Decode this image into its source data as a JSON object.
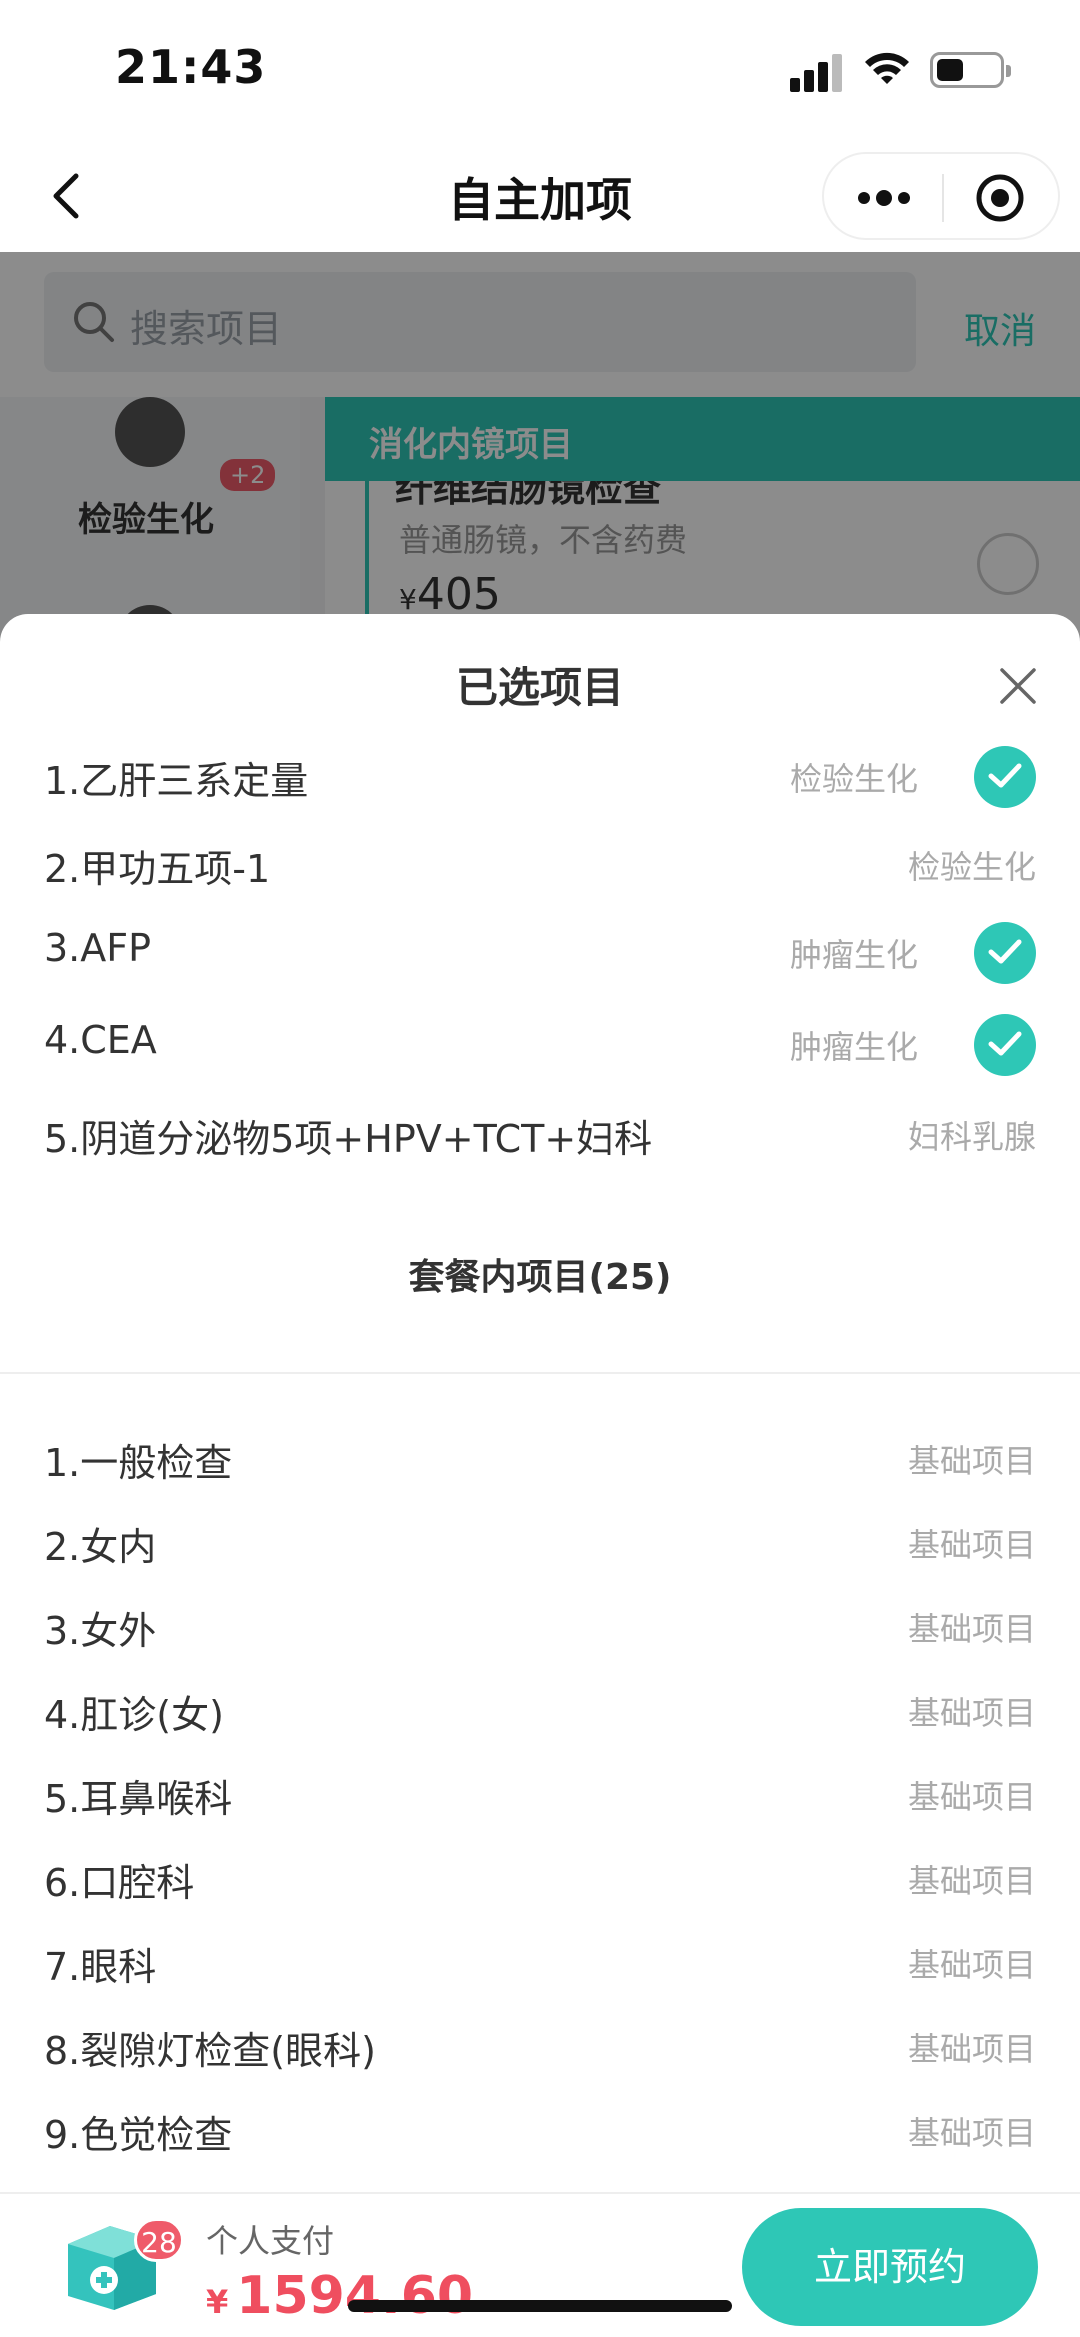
{
  "status_bar": {
    "time": "21:43"
  },
  "nav": {
    "title": "自主加项"
  },
  "search": {
    "placeholder": "搜索项目",
    "cancel": "取消"
  },
  "background": {
    "category_label": "检验生化",
    "category_badge": "+2",
    "section_header": "消化内镜项目",
    "card_title": "纤维结肠镜检查",
    "card_subtitle": "普通肠镜，不含药费",
    "card_currency": "¥",
    "card_price": "405"
  },
  "selected": {
    "title": "已选项目",
    "items": [
      {
        "name": "1.乙肝三系定量",
        "category": "检验生化",
        "checked": true
      },
      {
        "name": "2.甲功五项-1",
        "category": "检验生化",
        "checked": false
      },
      {
        "name": "3.AFP",
        "category": "肿瘤生化",
        "checked": true
      },
      {
        "name": "4.CEA",
        "category": "肿瘤生化",
        "checked": true
      },
      {
        "name": "5.阴道分泌物5项+HPV+TCT+妇科",
        "category": "妇科乳腺",
        "checked": false
      }
    ]
  },
  "package": {
    "title": "套餐内项目(25)",
    "items": [
      {
        "name": "1.一般检查",
        "category": "基础项目"
      },
      {
        "name": "2.女内",
        "category": "基础项目"
      },
      {
        "name": "3.女外",
        "category": "基础项目"
      },
      {
        "name": "4.肛诊(女)",
        "category": "基础项目"
      },
      {
        "name": "5.耳鼻喉科",
        "category": "基础项目"
      },
      {
        "name": "6.口腔科",
        "category": "基础项目"
      },
      {
        "name": "7.眼科",
        "category": "基础项目"
      },
      {
        "name": "8.裂隙灯检查(眼科)",
        "category": "基础项目"
      },
      {
        "name": "9.色觉检查",
        "category": "基础项目"
      }
    ]
  },
  "bottom": {
    "cart_count": "28",
    "pay_label": "个人支付",
    "currency": "¥",
    "amount": "1594.60",
    "book_button": "立即预约"
  },
  "colors": {
    "accent": "#2ec7b6",
    "price": "#ef4e5f",
    "badge": "#ef5b6a"
  }
}
